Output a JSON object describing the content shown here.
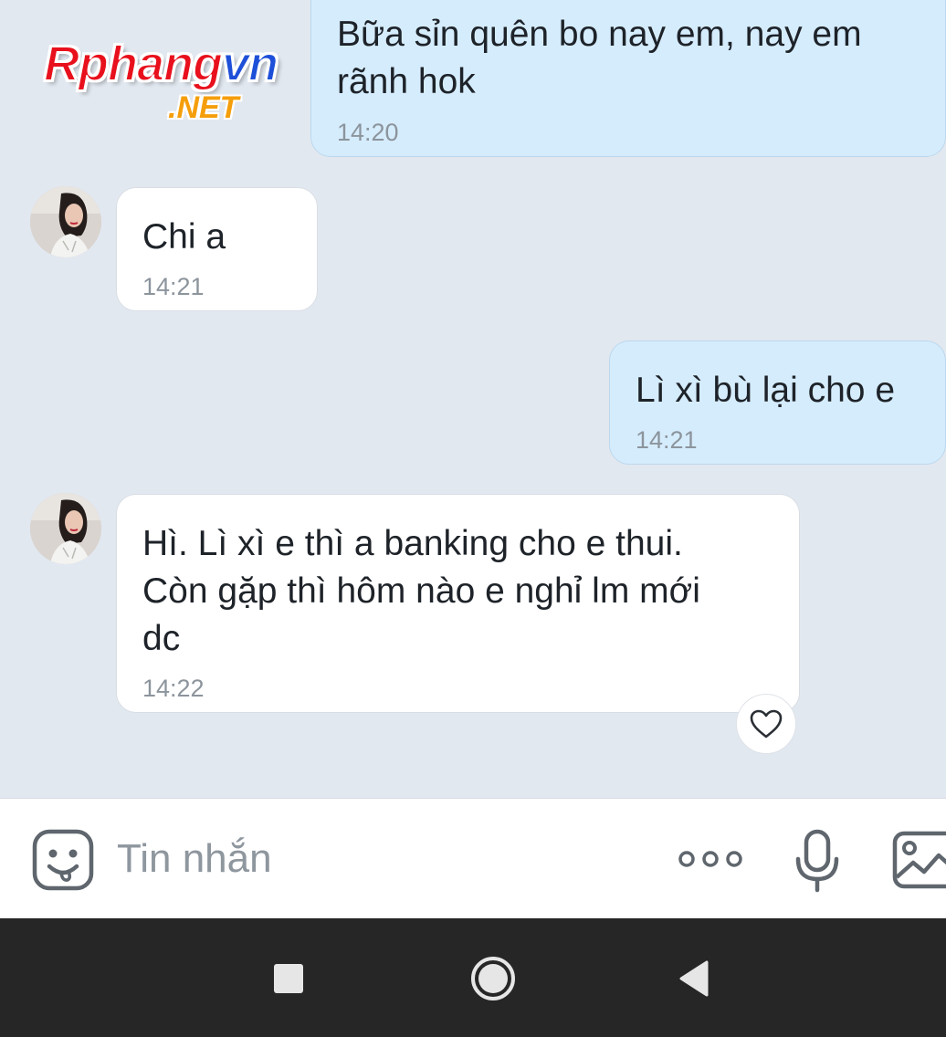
{
  "watermark": {
    "brand_red": "Rphang",
    "brand_blue": "vn",
    "suffix": ".NET"
  },
  "messages": [
    {
      "direction": "outgoing",
      "text": "Bữa sỉn quên bo nay em, nay em\nrãnh hok",
      "time": "14:20"
    },
    {
      "direction": "incoming",
      "text": "Chi a",
      "time": "14:21"
    },
    {
      "direction": "outgoing",
      "text": "Lì xì bù lại cho e",
      "time": "14:21"
    },
    {
      "direction": "incoming",
      "text": "Hì. Lì xì e thì a banking cho e thui.\nCòn gặp thì hôm nào e nghỉ lm mới\ndc",
      "time": "14:22"
    }
  ],
  "reaction": {
    "icon": "heart-outline-icon"
  },
  "composer": {
    "placeholder": "Tin nhắn",
    "icons": [
      "sticker-icon",
      "more-options-icon",
      "microphone-icon",
      "image-icon"
    ]
  },
  "navigation": {
    "icons": [
      "recent-apps-icon",
      "home-icon",
      "back-icon"
    ]
  },
  "colors": {
    "chat_background": "#e2e8f0",
    "outgoing_bubble": "#d5ecfd",
    "incoming_bubble": "#ffffff",
    "timestamp": "#8c949c",
    "nav_background": "#262626"
  }
}
